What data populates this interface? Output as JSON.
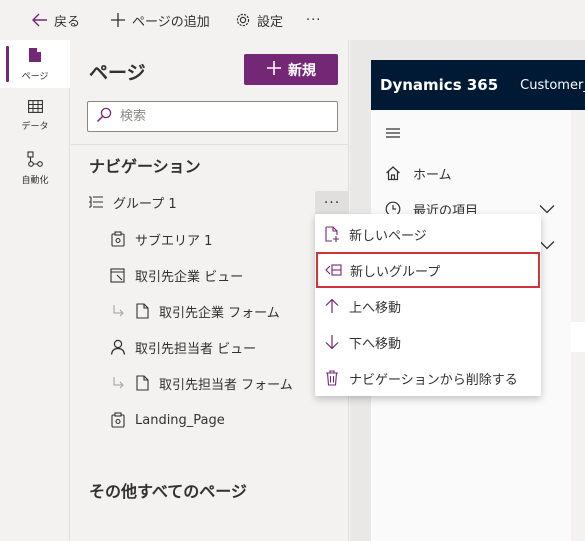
{
  "command_bar": {
    "back_label": "戻る",
    "add_page_label": "ページの追加",
    "settings_label": "設定",
    "more_label": "···"
  },
  "rail": {
    "items": [
      {
        "label": "ページ",
        "icon": "page-icon",
        "active": true
      },
      {
        "label": "データ",
        "icon": "table-icon",
        "active": false
      },
      {
        "label": "自動化",
        "icon": "flow-icon",
        "active": false
      }
    ]
  },
  "pages_panel": {
    "title": "ページ",
    "new_button_label": "新規",
    "search_placeholder": "検索",
    "navigation_title": "ナビゲーション",
    "group_label": "グループ 1",
    "more_label": "···",
    "nav_items": [
      {
        "label": "サブエリア 1",
        "icon": "subarea-icon"
      },
      {
        "label": "取引先企業 ビュー",
        "icon": "view-icon"
      },
      {
        "label": "取引先企業 フォーム",
        "icon": "form-icon"
      },
      {
        "label": "取引先担当者 ビュー",
        "icon": "person-icon"
      },
      {
        "label": "取引先担当者 フォーム",
        "icon": "form-icon"
      },
      {
        "label": "Landing_Page",
        "icon": "subarea-icon"
      }
    ],
    "other_pages_title": "その他すべてのページ"
  },
  "app_preview": {
    "brand": "Dynamics 365",
    "app_name": "Customer_M",
    "sitemap": [
      {
        "label": "ホーム",
        "icon": "home-icon",
        "chevron": false
      },
      {
        "label": "最近の項目",
        "icon": "clock-icon",
        "chevron": true
      }
    ]
  },
  "context_menu": {
    "items": [
      {
        "label": "新しいページ",
        "icon": "new-page-icon",
        "highlighted": false
      },
      {
        "label": "新しいグループ",
        "icon": "new-group-icon",
        "highlighted": true
      },
      {
        "label": "上へ移動",
        "icon": "arrow-up-icon",
        "highlighted": false
      },
      {
        "label": "下へ移動",
        "icon": "arrow-down-icon",
        "highlighted": false
      },
      {
        "label": "ナビゲーションから削除する",
        "icon": "delete-icon",
        "highlighted": false
      }
    ]
  },
  "colors": {
    "accent": "#742774",
    "header": "#001a35",
    "highlight_border": "#d13438"
  }
}
